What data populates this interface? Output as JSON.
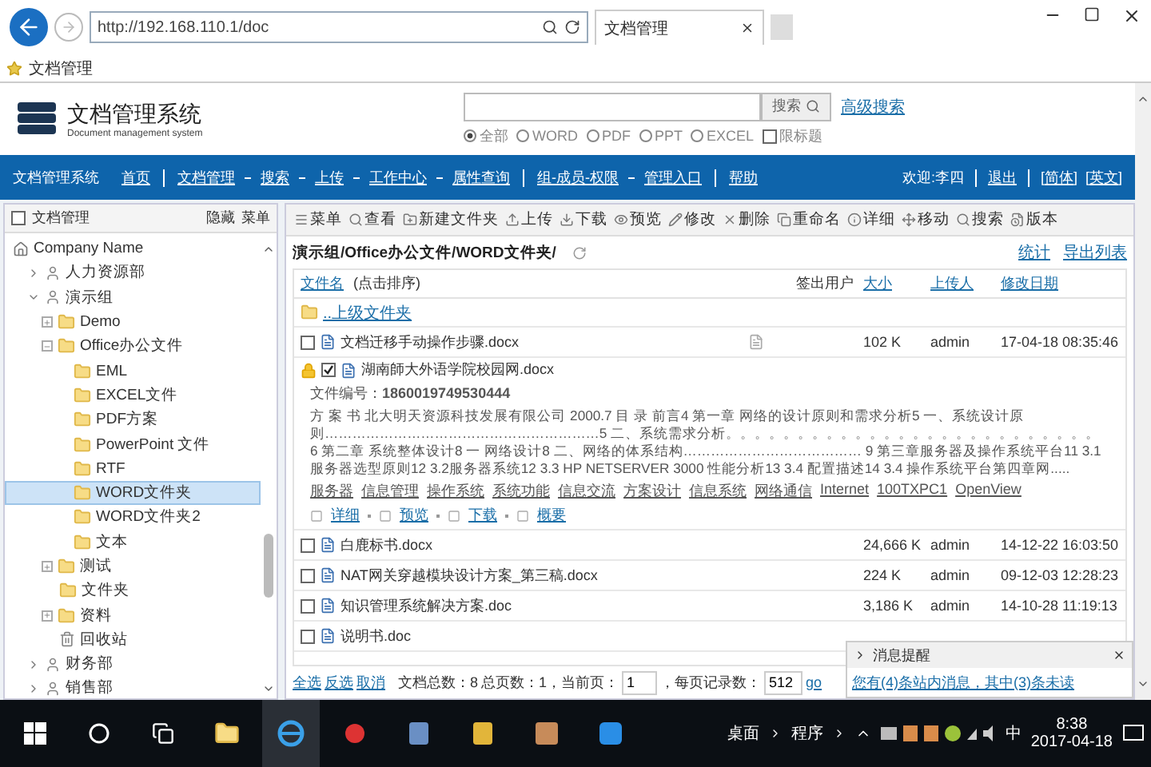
{
  "browser": {
    "url": "http://192.168.110.1/doc",
    "tab_title": "文档管理",
    "favorite": "文档管理"
  },
  "header": {
    "title": "文档管理系统",
    "subtitle": "Document management system",
    "search_button": "搜索",
    "advanced_search": "高级搜索",
    "filters": [
      {
        "label": "全部",
        "selected": true
      },
      {
        "label": "WORD",
        "selected": false
      },
      {
        "label": "PDF",
        "selected": false
      },
      {
        "label": "PPT",
        "selected": false
      },
      {
        "label": "EXCEL",
        "selected": false
      }
    ],
    "title_only": {
      "label": "限标题",
      "checked": false
    }
  },
  "nav": {
    "brand": "文档管理系统",
    "groups": [
      [
        "首页"
      ],
      [
        "文档管理",
        "搜索",
        "上传",
        "工作中心",
        "属性查询"
      ],
      [
        "组-成员-权限",
        "管理入口"
      ],
      [
        "帮助"
      ]
    ],
    "welcome": "欢迎:李四",
    "user_links": [
      "退出",
      "[简体]",
      "[英文]"
    ]
  },
  "sidebar": {
    "title": "文档管理",
    "hide": "隐藏",
    "menu": "菜单",
    "tree": [
      {
        "label": "Company Name",
        "kind": "root",
        "selected": false,
        "children": [
          {
            "label": "人力资源部",
            "kind": "dept",
            "expanded": false,
            "selected": false
          },
          {
            "label": "演示组",
            "kind": "dept",
            "expanded": true,
            "selected": false,
            "children": [
              {
                "label": "Demo",
                "kind": "folder",
                "expanded": false,
                "selected": false
              },
              {
                "label": "Office办公文件",
                "kind": "folder",
                "expanded": true,
                "selected": false,
                "children": [
                  {
                    "label": "EML",
                    "kind": "folder",
                    "selected": false
                  },
                  {
                    "label": "EXCEL文件",
                    "kind": "folder",
                    "selected": false
                  },
                  {
                    "label": "PDF方案",
                    "kind": "folder",
                    "selected": false
                  },
                  {
                    "label": "PowerPoint 文件",
                    "kind": "folder",
                    "selected": false
                  },
                  {
                    "label": "RTF",
                    "kind": "folder",
                    "selected": false
                  },
                  {
                    "label": "WORD文件夹",
                    "kind": "folder",
                    "selected": true
                  },
                  {
                    "label": "WORD文件夹2",
                    "kind": "folder",
                    "selected": false
                  },
                  {
                    "label": "文本",
                    "kind": "folder",
                    "selected": false
                  }
                ]
              },
              {
                "label": "测试",
                "kind": "folder",
                "expanded": false,
                "selected": false
              },
              {
                "label": "文件夹",
                "kind": "folder",
                "selected": false
              },
              {
                "label": "资料",
                "kind": "folder",
                "expanded": false,
                "selected": false
              },
              {
                "label": "回收站",
                "kind": "trash",
                "selected": false
              }
            ]
          },
          {
            "label": "财务部",
            "kind": "dept",
            "expanded": false,
            "selected": false
          },
          {
            "label": "销售部",
            "kind": "dept",
            "expanded": false,
            "selected": false
          }
        ]
      }
    ]
  },
  "toolbar": [
    "菜单",
    "查看",
    "新建文件夹",
    "上传",
    "下载",
    "预览",
    "修改",
    "删除",
    "重命名",
    "详细",
    "移动",
    "搜索",
    "版本"
  ],
  "path": "演示组/Office办公文件/WORD文件夹/",
  "path_links": [
    "统计",
    "导出列表"
  ],
  "table": {
    "columns": [
      {
        "label": "文件名",
        "hint": "(点击排序)",
        "link": true
      },
      {
        "label": "签出用户",
        "link": false
      },
      {
        "label": "大小",
        "link": true
      },
      {
        "label": "上传人",
        "link": true
      },
      {
        "label": "修改日期",
        "link": true
      }
    ],
    "up_folder": "..上级文件夹",
    "rows": [
      {
        "name": "文档迁移手动操作步骤.docx",
        "checked": false,
        "locked": false,
        "note": true,
        "size": "102 K",
        "uploader": "admin",
        "date": "17-04-18 08:35:46"
      },
      {
        "name": "湖南師大外语学院校园网.docx",
        "checked": true,
        "locked": true,
        "note": false,
        "detail": {
          "number_label": "文件编号：",
          "number": "1860019749530444",
          "summary": "方 案 书 北大明天资源科技发展有限公司 2000.7 目 录 前言4 第一章 网络的设计原则和需求分析5 一、系统设计原则……………………………………………………5 二、系统需求分析。。。。。。。。。。。。。。。。。。。。。。。。。。 6 第二章 系统整体设计8 一 网络设计8 二、网络的体系结构………………………………… 9 第三章服务器及操作系统平台11 3.1服务器选型原则12 3.2服务器系统12 3.3 HP NETSERVER 3000 性能分析13 3.4 配置描述14 3.4 操作系统平台第四章网.....",
          "tags": [
            "服务器",
            "信息管理",
            "操作系统",
            "系统功能",
            "信息交流",
            "方案设计",
            "信息系统",
            "网络通信",
            "Internet",
            "100TXPC1",
            "OpenView"
          ],
          "actions": [
            "详细",
            "预览",
            "下载",
            "概要"
          ]
        }
      },
      {
        "name": "白鹿标书.docx",
        "checked": false,
        "locked": false,
        "note": false,
        "size": "24,666 K",
        "uploader": "admin",
        "date": "14-12-22 16:03:50"
      },
      {
        "name": "NAT网关穿越模块设计方案_第三稿.docx",
        "checked": false,
        "locked": false,
        "note": false,
        "size": "224 K",
        "uploader": "admin",
        "date": "09-12-03 12:28:23"
      },
      {
        "name": "知识管理系统解决方案.doc",
        "checked": false,
        "locked": false,
        "note": false,
        "size": "3,186 K",
        "uploader": "admin",
        "date": "14-10-28 11:19:13"
      },
      {
        "name": "说明书.doc",
        "checked": false,
        "locked": false,
        "note": false
      }
    ]
  },
  "footer": {
    "links": [
      "全选",
      "反选",
      "取消"
    ],
    "total": "文档总数：8",
    "pages": "总页数：1，当前页：",
    "page": "1",
    "per_page_label": "，每页记录数：",
    "per_page": "512",
    "go": "go"
  },
  "message": {
    "title": "消息提醒",
    "text": "您有(4)条站内消息，其中(3)条未读"
  },
  "taskbar": {
    "toolbars": [
      "桌面",
      "程序"
    ],
    "ime": "中",
    "time": "8:38",
    "date": "2017-04-18"
  }
}
